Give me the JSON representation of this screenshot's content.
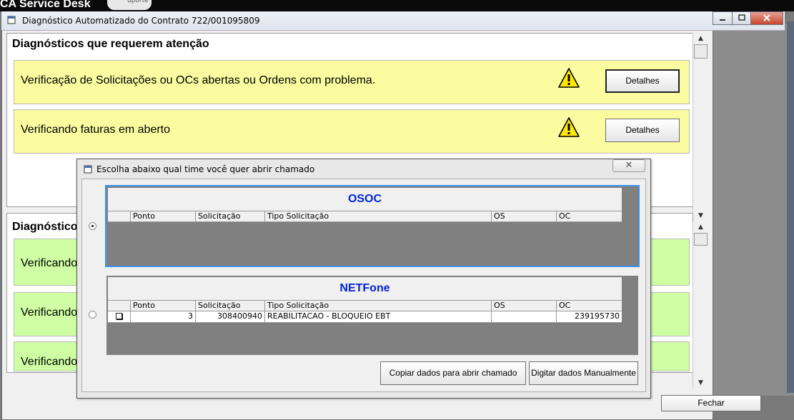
{
  "background_app": {
    "title": "CA Service Desk",
    "logo_text": "uporte"
  },
  "window": {
    "title": "Diagnóstico Automatizado do Contrato 722/001095809",
    "controls": [
      "minimize",
      "maximize",
      "close"
    ]
  },
  "section_attention": {
    "title": "Diagnósticos que requerem atenção",
    "items": [
      {
        "text": "Verificação de Solicitações ou OCs abertas ou Ordens com problema.",
        "button": "Detalhes",
        "icon": "warning-icon"
      },
      {
        "text": "Verificando faturas em aberto",
        "button": "Detalhes",
        "icon": "warning-icon"
      }
    ]
  },
  "section_ok": {
    "title": "Diagnóstico",
    "items": [
      {
        "text": "Verificando"
      },
      {
        "text": "Verificando"
      },
      {
        "text": "Verificando"
      }
    ]
  },
  "footer": {
    "close_button": "Fechar"
  },
  "dialog": {
    "title": "Escolha abaixo qual time você quer abrir chamado",
    "close_glyph": "✕",
    "teams": [
      {
        "name": "OSOC",
        "selected": true,
        "columns": [
          "",
          "Ponto",
          "Solicitação",
          "Tipo Solicitação",
          "OS",
          "OC"
        ],
        "rows": []
      },
      {
        "name": "NETFone",
        "selected": false,
        "columns": [
          "",
          "Ponto",
          "Solicitação",
          "Tipo Solicitação",
          "OS",
          "OC"
        ],
        "rows": [
          {
            "checked": false,
            "ponto": "3",
            "solicitacao": "308400940",
            "tipo": "REABILITACAO - BLOQUEIO EBT",
            "os": "",
            "oc": "239195730"
          }
        ]
      }
    ],
    "buttons": {
      "copy": "Copiar dados para abrir chamado",
      "manual": "Digitar dados Manualmente"
    }
  },
  "colors": {
    "warning_row": "#fbfba0",
    "ok_row": "#cfffa4",
    "team_title": "#0026d8",
    "selection": "#3d94e8"
  }
}
